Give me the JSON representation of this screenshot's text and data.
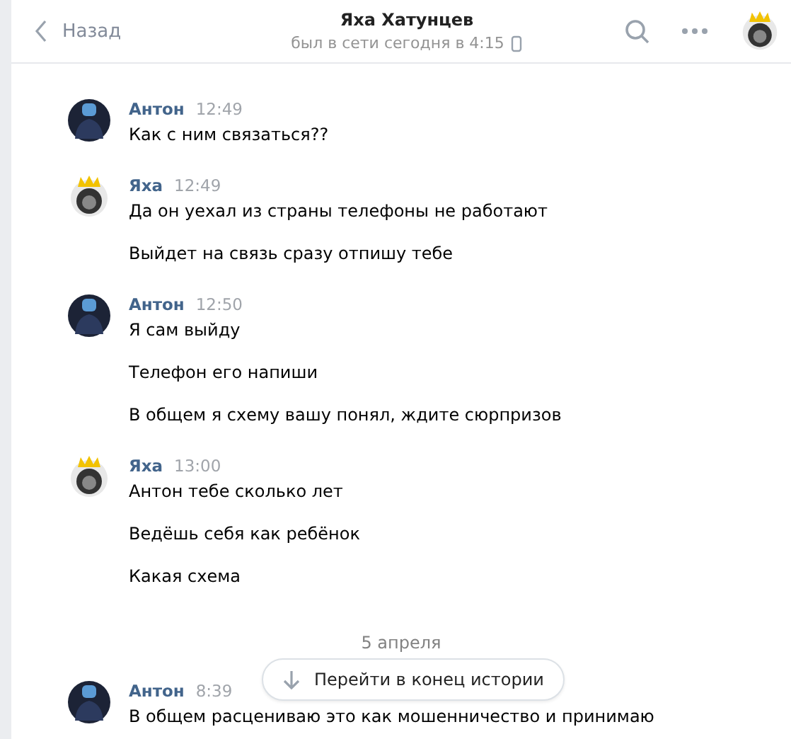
{
  "header": {
    "back": "Назад",
    "title": "Яха Хатунцев",
    "status": "был в сети сегодня в 4:15"
  },
  "groups": [
    {
      "kind": "man",
      "author": "Антон",
      "time": "12:49",
      "messages": [
        "Как с ним связаться??"
      ]
    },
    {
      "kind": "lion",
      "author": "Яха",
      "time": "12:49",
      "messages": [
        "Да он уехал из страны телефоны не работают",
        "Выйдет на связь сразу отпишу тебе"
      ]
    },
    {
      "kind": "man",
      "author": "Антон",
      "time": "12:50",
      "messages": [
        "Я сам выйду",
        "Телефон его напиши",
        "В общем я схему вашу понял, ждите сюрпризов"
      ]
    },
    {
      "kind": "lion",
      "author": "Яха",
      "time": "13:00",
      "messages": [
        "Антон тебе сколько лет",
        "Ведёшь себя как ребёнок",
        "Какая схема"
      ]
    }
  ],
  "date_divider": "5 апреля",
  "last_group": {
    "kind": "man",
    "author": "Антон",
    "time": "8:39",
    "messages": [
      "В общем расцениваю это как мошенничество и принимаю"
    ]
  },
  "jump_button": "Перейти в конец истории"
}
